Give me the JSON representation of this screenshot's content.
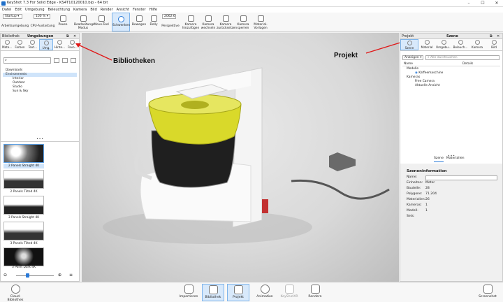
{
  "window": {
    "title": "KeyShot 7.3 For Solid Edge - KS4T10120010.bip - 64 bit",
    "min": "–",
    "max": "☐",
    "close": "✕"
  },
  "menu": [
    "Datei",
    "Edit",
    "Umgebung",
    "Beleuchtung",
    "Kamera",
    "Bild",
    "Render",
    "Ansicht",
    "Fenster",
    "Hilfe"
  ],
  "toolbar": {
    "workspace": "Startup",
    "cpu": "100 %",
    "fov": "2062.6",
    "buttons": [
      "Arbeitsumgebung",
      "CPU-Auslastung",
      "Pause",
      "Bearbeitungs-Modus",
      "Move-Tool",
      "Schwenken",
      "Bewegen",
      "Dolly",
      "Perspektive",
      "Kamera hinzufügen",
      "Kamera wechseln",
      "Kamera zurücksetzen",
      "Kamera sperren",
      "Material-Vorlagen"
    ]
  },
  "library": {
    "head_left": "Bibliothek",
    "head_center": "Umgebungen",
    "tabs": [
      "Mate...",
      "Farben",
      "Text...",
      "Umg.",
      "Hinte...",
      "Favo..."
    ],
    "tree": [
      "Downloads",
      "Environments",
      "Interior",
      "Outdoor",
      "Studio",
      "Sun & Sky"
    ],
    "thumbs": [
      "2 Panels Straight 4K",
      "2 Panels Tilted 4K",
      "3 Panels Straight 4K",
      "3 Panels Tilted 4K",
      "3 Point Dark 4K"
    ],
    "dots": "• • •"
  },
  "project": {
    "head_left": "Projekt",
    "head_center": "Szene",
    "tabs": [
      "Szene",
      "Material",
      "Umgebu...",
      "Beleuch...",
      "Kamera",
      "Bild"
    ],
    "filter": "Anzeigen",
    "search_placeholder": "Alle durchsuchen",
    "col_name": "Name",
    "col_details": "Details",
    "tree": [
      "Modelle",
      "Kaffeemaschine",
      "Kameras",
      "Free Camera",
      "Aktuelle Ansicht"
    ],
    "subtabs": [
      "Szene",
      "Materialien"
    ],
    "info_title": "Szeneninformation",
    "info": [
      {
        "k": "Name:",
        "v": ""
      },
      {
        "k": "Einheiten:",
        "v": "Meter"
      },
      {
        "k": "Bauteile:",
        "v": "28"
      },
      {
        "k": "Polygone:",
        "v": "71.204"
      },
      {
        "k": "Materialien:",
        "v": "26"
      },
      {
        "k": "Kameras:",
        "v": "1"
      },
      {
        "k": "Modell-Sets:",
        "v": "1"
      }
    ]
  },
  "annotations": {
    "left": "Bibliotheken",
    "right": "Projekt"
  },
  "bottom": {
    "cloud": "Cloud-Bibliothek",
    "buttons": [
      "Importieren",
      "Bibliothek",
      "Projekt",
      "Animation",
      "KeyShotXR",
      "Rendern"
    ],
    "screenshot": "Screenshot"
  },
  "colors": {
    "accent": "#7eb4ea",
    "selected": "#d8e9fb",
    "annotation_arrow": "#e01818",
    "carafe_lid": "#d9d92a"
  }
}
